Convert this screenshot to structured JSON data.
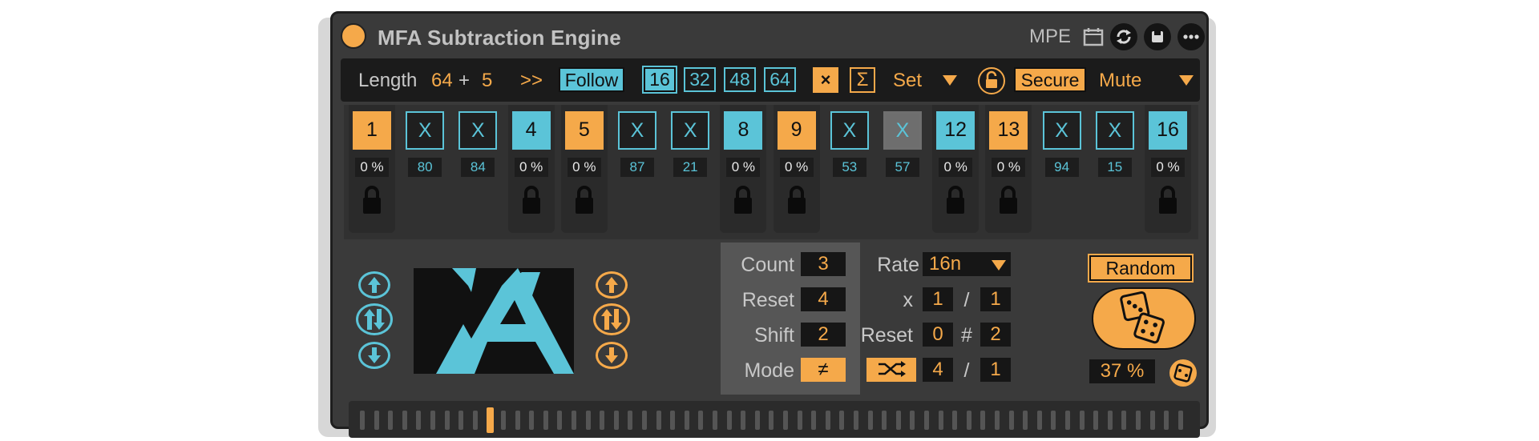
{
  "device": {
    "title": "MFA Subtraction Engine",
    "mpe_label": "MPE",
    "icons": [
      "calendar-icon",
      "sync-icon",
      "save-icon",
      "more-icon"
    ]
  },
  "toolbar": {
    "length_label": "Length",
    "length_base": "64",
    "plus": "+",
    "length_add": "5",
    "advance": ">>",
    "follow": "Follow",
    "lengths": [
      "16",
      "32",
      "48",
      "64"
    ],
    "selected_length": "16",
    "clear": "×",
    "sigma": "Σ",
    "set_label": "Set",
    "secure": "Secure",
    "mute": "Mute"
  },
  "steps": [
    {
      "label": "1",
      "state": "orange",
      "value": "0 %",
      "locked": true
    },
    {
      "label": "X",
      "state": "x",
      "value": "80",
      "locked": false
    },
    {
      "label": "X",
      "state": "x",
      "value": "84",
      "locked": false
    },
    {
      "label": "4",
      "state": "cyan",
      "value": "0 %",
      "locked": true
    },
    {
      "label": "5",
      "state": "orange",
      "value": "0 %",
      "locked": true
    },
    {
      "label": "X",
      "state": "x",
      "value": "87",
      "locked": false
    },
    {
      "label": "X",
      "state": "x",
      "value": "21",
      "locked": false
    },
    {
      "label": "8",
      "state": "cyan",
      "value": "0 %",
      "locked": true
    },
    {
      "label": "9",
      "state": "orange",
      "value": "0 %",
      "locked": true
    },
    {
      "label": "X",
      "state": "x",
      "value": "53",
      "locked": false
    },
    {
      "label": "X",
      "state": "xg",
      "value": "57",
      "locked": false
    },
    {
      "label": "12",
      "state": "cyan",
      "value": "0 %",
      "locked": true
    },
    {
      "label": "13",
      "state": "orange",
      "value": "0 %",
      "locked": true
    },
    {
      "label": "X",
      "state": "x",
      "value": "94",
      "locked": false
    },
    {
      "label": "X",
      "state": "x",
      "value": "15",
      "locked": false
    },
    {
      "label": "16",
      "state": "cyan",
      "value": "0 %",
      "locked": true
    }
  ],
  "counter": {
    "count_label": "Count",
    "count": "3",
    "reset_label": "Reset",
    "reset": "4",
    "shift_label": "Shift",
    "shift": "2",
    "mode_label": "Mode",
    "mode": "≠"
  },
  "rate": {
    "rate_label": "Rate",
    "rate": "16n",
    "x_label": "x",
    "mult_a": "1",
    "slash": "/",
    "mult_b": "1",
    "reset_label": "Reset",
    "reset_a": "0",
    "hash": "#",
    "reset_b": "2",
    "shuffle_a": "4",
    "shuffle_b": "1"
  },
  "random": {
    "button": "Random",
    "percent": "37 %"
  },
  "colors": {
    "orange": "#f5a94a",
    "cyan": "#5bc4d8",
    "panel": "#3a3a3a"
  },
  "scrubber": {
    "ticks": 59,
    "position_index": 9
  }
}
